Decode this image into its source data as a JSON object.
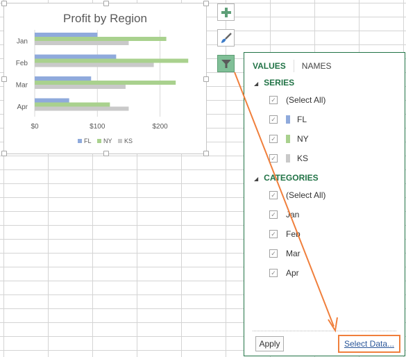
{
  "chart": {
    "title": "Profit by Region",
    "legend": [
      {
        "label": "FL",
        "color": "#8faadc"
      },
      {
        "label": "NY",
        "color": "#a9d18e"
      },
      {
        "label": "KS",
        "color": "#c9c9c9"
      }
    ]
  },
  "chart_data": {
    "type": "bar",
    "orientation": "horizontal",
    "title": "Profit by Region",
    "categories": [
      "Jan",
      "Feb",
      "Mar",
      "Apr"
    ],
    "series": [
      {
        "name": "FL",
        "color": "#8faadc",
        "values": [
          100,
          130,
          90,
          55
        ]
      },
      {
        "name": "NY",
        "color": "#a9d18e",
        "values": [
          210,
          245,
          225,
          120
        ]
      },
      {
        "name": "KS",
        "color": "#c9c9c9",
        "values": [
          150,
          190,
          145,
          150
        ]
      }
    ],
    "xticks": [
      "$0",
      "$100",
      "$200"
    ],
    "xlim": [
      0,
      260
    ],
    "xlabel": "",
    "ylabel": "",
    "grid": true,
    "legend_position": "bottom"
  },
  "side_buttons": [
    {
      "name": "chart-elements",
      "icon": "plus-icon"
    },
    {
      "name": "chart-styles",
      "icon": "paintbrush-icon"
    },
    {
      "name": "chart-filters",
      "icon": "filter-icon",
      "active": true
    }
  ],
  "panel": {
    "tabs": {
      "values": "VALUES",
      "names": "NAMES"
    },
    "series_heading": "SERIES",
    "series_items": [
      {
        "label": "(Select All)",
        "checked": true
      },
      {
        "label": "FL",
        "checked": true,
        "color": "#8faadc"
      },
      {
        "label": "NY",
        "checked": true,
        "color": "#a9d18e"
      },
      {
        "label": "KS",
        "checked": true,
        "color": "#c9c9c9"
      }
    ],
    "categories_heading": "CATEGORIES",
    "category_items": [
      {
        "label": "(Select All)",
        "checked": true
      },
      {
        "label": "Jan",
        "checked": true
      },
      {
        "label": "Feb",
        "checked": true
      },
      {
        "label": "Mar",
        "checked": true
      },
      {
        "label": "Apr",
        "checked": true
      }
    ],
    "apply_label": "Apply",
    "select_data_label": "Select Data...",
    "checkmark": "✓",
    "collapse_glyph": "◢"
  },
  "annotation": {
    "color": "#f07f3c"
  }
}
